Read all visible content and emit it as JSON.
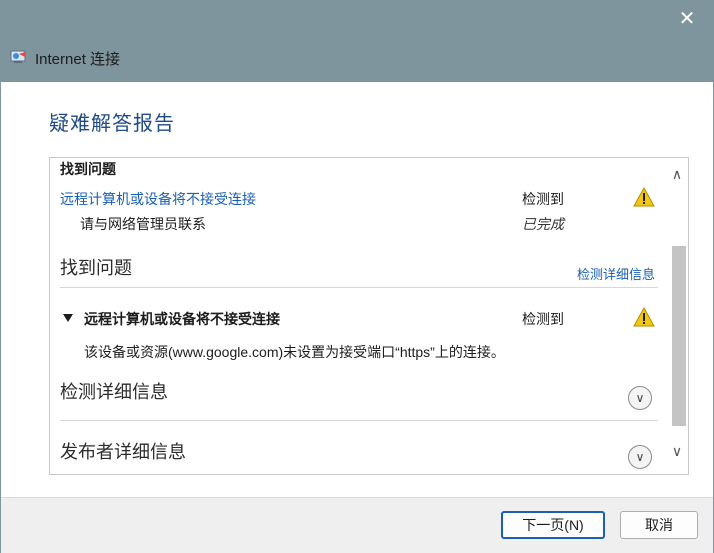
{
  "window": {
    "title": "Internet 连接",
    "close_glyph": "✕"
  },
  "report": {
    "heading": "疑难解答报告",
    "summary_section_title": "找到问题",
    "summary_issue_link": "远程计算机或设备将不接受连接",
    "summary_issue_status": "检测到",
    "summary_action_text": "请与网络管理员联系",
    "summary_action_status": "已完成",
    "issues_found_title": "找到问题",
    "detection_details_link": "检测详细信息",
    "issue_title": "远程计算机或设备将不接受连接",
    "issue_status": "检测到",
    "issue_description": "该设备或资源(www.google.com)未设置为接受端口“https”上的连接。",
    "detection_details_section": "检测详细信息",
    "publisher_details_section": "发布者详细信息"
  },
  "buttons": {
    "next_label": "下一页(N)",
    "cancel_label": "取消"
  },
  "colors": {
    "titlebar": "#7f959e",
    "heading": "#1f4a86",
    "link": "#1a5fb4",
    "warning": "#f2c811"
  },
  "icons": {
    "app": "network-connection-icon",
    "warning": "warning-icon",
    "expand": "chevron-down-icon",
    "collapse": "triangle-down-icon",
    "scroll_up": "chevron-up-icon",
    "scroll_down": "chevron-down-icon"
  }
}
